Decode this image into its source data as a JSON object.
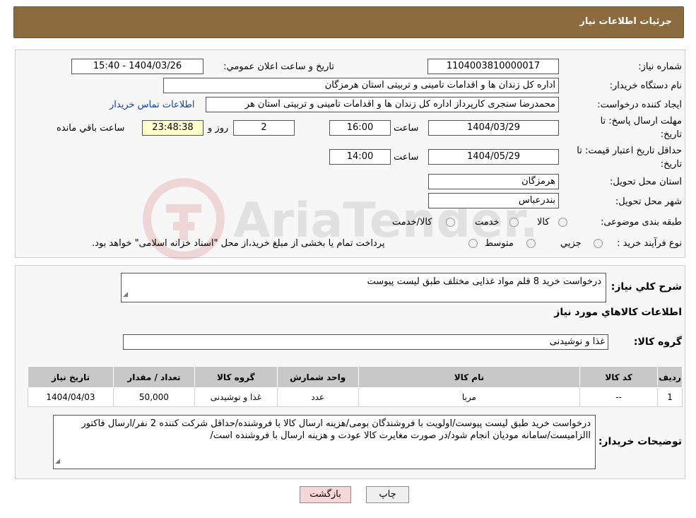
{
  "header": {
    "title": "جزئیات اطلاعات نیاز"
  },
  "form": {
    "need_number_label": "شماره نیاز:",
    "need_number": "1104003810000017",
    "announce_label": "تاریخ و ساعت اعلان عمومي:",
    "announce_value": "1404/03/26 - 15:40",
    "buyer_org_label": "نام دستگاه خریدار:",
    "buyer_org": "اداره کل زندان ها و اقدامات تامینی و تربیتی استان هرمزگان",
    "requester_label": "ایجاد کننده درخواست:",
    "requester": "محمدرضا سنجری کارپرداز اداره کل زندان ها و اقدامات تامینی و تربیتی استان هر",
    "contact_link": "اطلاعات تماس خریدار",
    "deadline_label_1": "مهلت ارسال پاسخ: تا",
    "deadline_label_2": "تاریخ:",
    "deadline_date": "1404/03/29",
    "time_label": "ساعت",
    "deadline_time": "16:00",
    "days_value": "2",
    "days_label": "روز و",
    "remaining_time": "23:48:38",
    "remaining_label": "ساعت باقي مانده",
    "price_valid_label_1": "حداقل تاریخ اعتبار قیمت: تا",
    "price_valid_label_2": "تاریخ:",
    "price_valid_date": "1404/05/29",
    "price_valid_time": "14:00",
    "province_label": "استان محل تحویل:",
    "province": "هرمزگان",
    "city_label": "شهر محل تحویل:",
    "city": "بندرعباس",
    "category_label": "طبقه بندی موضوعی:",
    "category_options": [
      "کالا",
      "خدمت",
      "کالا/خدمت"
    ],
    "process_label": "نوع فرآیند خرید :",
    "process_options": [
      "جزیي",
      "متوسط"
    ],
    "process_note": "پرداخت تمام یا بخشی از مبلغ خرید،از محل \"اسناد خزانه اسلامی\" خواهد بود."
  },
  "details": {
    "summary_label": "شرح کلي نیاز:",
    "summary": "درخواست خرید 8 قلم مواد غذایی مختلف طبق لیست پیوست",
    "goods_info_title": "اطلاعات کالاهاي مورد نیاز",
    "goods_group_label": "گروه کالا:",
    "goods_group": "غذا و نوشیدنی",
    "table_headers": [
      "ردیف",
      "کد کالا",
      "نام کالا",
      "واحد شمارش",
      "گروه کالا",
      "تعداد / مقدار",
      "تاریخ نیاز"
    ],
    "table_rows": [
      [
        "1",
        "--",
        "مربا",
        "عدد",
        "غذا و نوشیدنی",
        "50,000",
        "1404/04/03"
      ]
    ],
    "buyer_notes_label": "توضیحات خریدار:",
    "buyer_notes": "درخواست خرید طبق لیست پیوست/اولویت با فروشندگان بومی/هزینه ارسال کالا با فروشنده/حداقل شرکت کننده 2 نفر/ارسال فاکتور االزامیست/سامانه مودیان انجام شود/در صورت مغایرت کالا عودت و هزینه ارسال با فروشنده است/"
  },
  "buttons": {
    "print": "چاپ",
    "back": "بازگشت"
  },
  "watermark_text": "AriaTender.neT",
  "colors": {
    "header_bg": "#8b6a3e",
    "link": "#0645ad",
    "back_button": "#f7d7d7",
    "remaining_bg": "#ffffcc"
  }
}
